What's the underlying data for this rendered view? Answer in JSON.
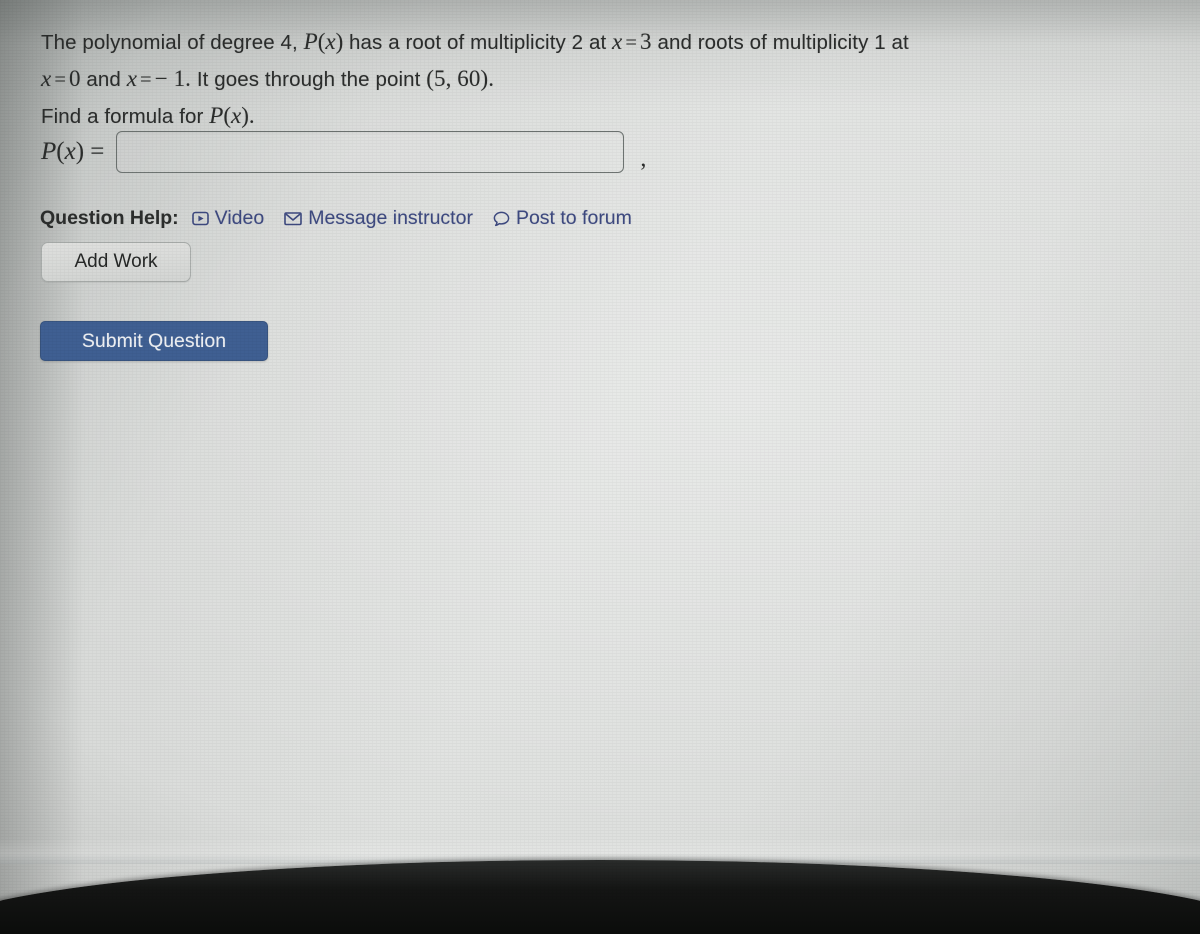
{
  "problem": {
    "line1_a": "The polynomial of degree 4,",
    "line1_px": "P(x)",
    "line1_b": "has a root of multiplicity 2 at",
    "line1_x": "x",
    "line1_eq": "=",
    "line1_three": "3",
    "line1_c": "and roots of multiplicity 1 at",
    "line2_x1": "x",
    "line2_eq1": "=",
    "line2_zero": "0",
    "line2_and": "and",
    "line2_x2": "x",
    "line2_eq2": "=",
    "line2_minus": "−",
    "line2_one": "1.",
    "line2_b": "It goes through the point",
    "line2_point": "(5, 60).",
    "line3_a": "Find a formula for",
    "line3_px": "P(x)",
    "line3_period": "."
  },
  "answer": {
    "label_p": "P",
    "label_paren_open": "(",
    "label_x": "x",
    "label_paren_close": ")",
    "label_eq": "=",
    "value": "",
    "placeholder": "",
    "trailing_comma": ","
  },
  "question_help": {
    "label": "Question Help:",
    "links": [
      {
        "icon": "video-icon",
        "text": "Video"
      },
      {
        "icon": "envelope-icon",
        "text": "Message instructor"
      },
      {
        "icon": "speech-bubble-icon",
        "text": "Post to forum"
      }
    ]
  },
  "buttons": {
    "add_work": "Add Work",
    "submit_question": "Submit Question"
  },
  "colors": {
    "page_background": "#dcdedc",
    "text": "#2b2d2c",
    "link": "#3e4a80",
    "submit_button": "#3f5f92",
    "submit_button_text": "#eef0f3",
    "input_border": "#6e7472",
    "add_work_border": "#a9adab"
  }
}
